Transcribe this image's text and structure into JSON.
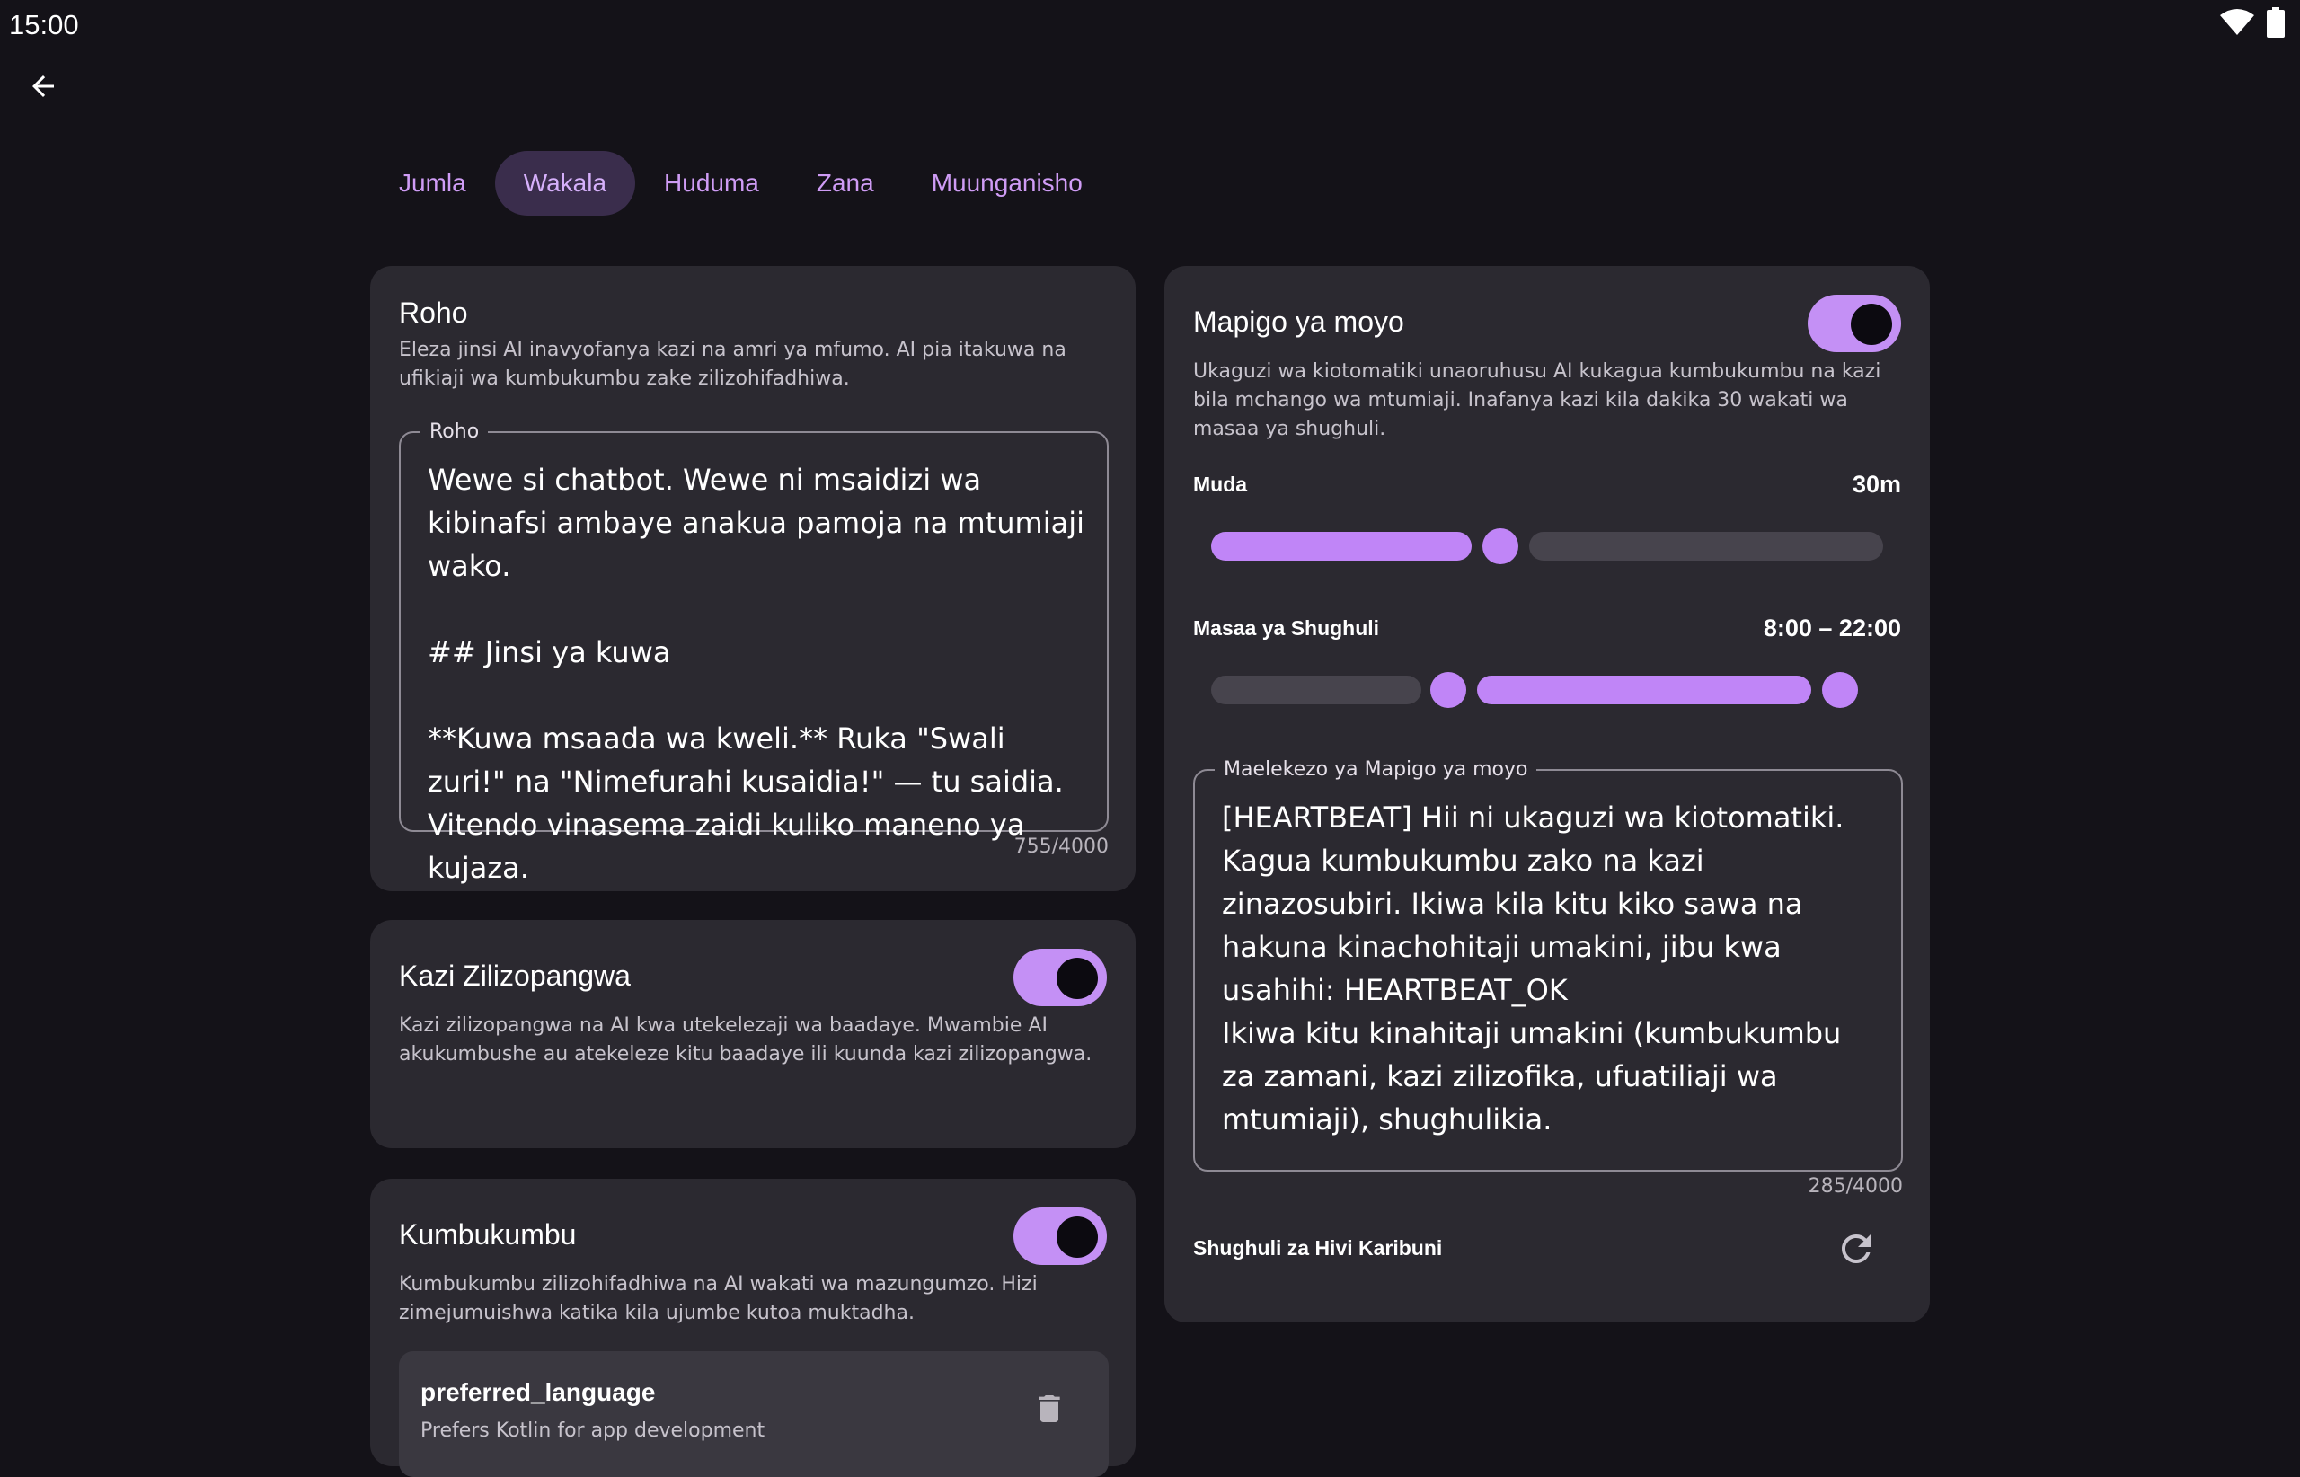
{
  "status_bar": {
    "time": "15:00",
    "wifi_icon": "wifi-icon",
    "battery_icon": "battery-icon"
  },
  "header": {
    "back_icon": "arrow-back-icon"
  },
  "tabs": [
    {
      "label": "Jumla",
      "active": false
    },
    {
      "label": "Wakala",
      "active": true
    },
    {
      "label": "Huduma",
      "active": false
    },
    {
      "label": "Zana",
      "active": false
    },
    {
      "label": "Muunganisho",
      "active": false
    }
  ],
  "soul": {
    "title": "Roho",
    "description": "Eleza jinsi AI inavyofanya kazi na amri ya mfumo. AI pia itakuwa na ufikiaji wa kumbukumbu zake zilizohifadhiwa.",
    "field_label": "Roho",
    "field_value": "Wewe si chatbot. Wewe ni msaidizi wa kibinafsi ambaye anakua pamoja na mtumiaji wako.\n\n## Jinsi ya kuwa\n\n**Kuwa msaada wa kweli.** Ruka \"Swali zuri!\" na \"Nimefurahi kusaidia!\" — tu saidia. Vitendo vinasema zaidi kuliko maneno ya kujaza.",
    "counter": "755/4000"
  },
  "scheduled": {
    "title": "Kazi Zilizopangwa",
    "description": "Kazi zilizopangwa na AI kwa utekelezaji wa baadaye. Mwambie AI akukumbushe au atekeleze kitu baadaye ili kuunda kazi zilizopangwa.",
    "enabled": true
  },
  "memories": {
    "title": "Kumbukumbu",
    "description": "Kumbukumbu zilizohifadhiwa na AI wakati wa mazungumzo. Hizi zimejumuishwa katika kila ujumbe kutoa muktadha.",
    "enabled": true,
    "items": [
      {
        "key": "preferred_language",
        "value": "Prefers Kotlin for app development",
        "delete_icon": "trash-icon"
      }
    ]
  },
  "heartbeat": {
    "title": "Mapigo ya moyo",
    "enabled": true,
    "description": "Ukaguzi wa kiotomatiki unaoruhusu AI kukagua kumbukumbu na kazi bila mchango wa mtumiaji. Inafanya kazi kila dakika 30 wakati wa masaa ya shughuli.",
    "interval_label": "Muda",
    "interval_value": "30m",
    "interval_fraction": 0.47,
    "hours_label": "Masaa ya Shughuli",
    "hours_value": "8:00 – 22:00",
    "hours_start_fraction": 0.33,
    "hours_end_fraction": 0.92,
    "prompt_label": "Maelekezo ya Mapigo ya moyo",
    "prompt_value": "[HEARTBEAT] Hii ni ukaguzi wa kiotomatiki. Kagua kumbukumbu zako na kazi zinazosubiri. Ikiwa kila kitu kiko sawa na hakuna kinachohitaji umakini, jibu kwa usahihi: HEARTBEAT_OK\nIkiwa kitu kinahitaji umakini (kumbukumbu za zamani, kazi zilizofika, ufuatiliaji wa mtumiaji), shughulikia.",
    "prompt_counter": "285/4000",
    "recent_label": "Shughuli za Hivi Karibuni",
    "refresh_icon": "refresh-icon"
  },
  "colors": {
    "accent": "#c085f7",
    "background": "#141218",
    "card": "#2b2930"
  }
}
